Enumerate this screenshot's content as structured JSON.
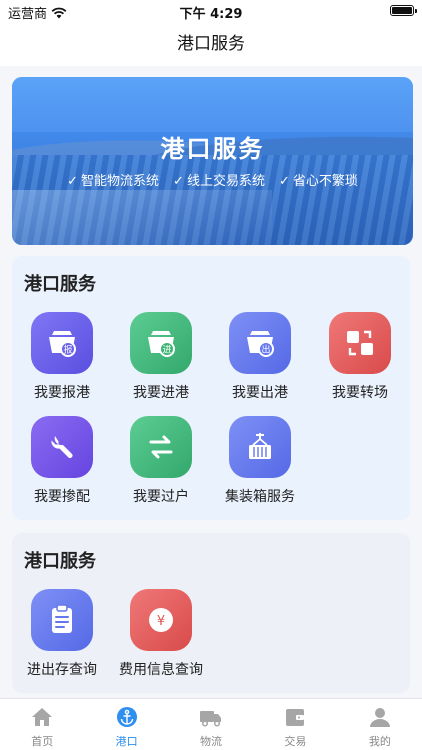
{
  "status_bar": {
    "carrier": "运营商",
    "time": "下午 4:29"
  },
  "nav": {
    "title": "港口服务"
  },
  "banner": {
    "title": "港口服务",
    "features": [
      "智能物流系统",
      "线上交易系统",
      "省心不繁琐"
    ]
  },
  "section1": {
    "title": "港口服务",
    "items": [
      {
        "label": "我要报港",
        "icon": "ship-report-icon",
        "color": "#6c63ee"
      },
      {
        "label": "我要进港",
        "icon": "ship-enter-icon",
        "color": "#3fb57b"
      },
      {
        "label": "我要出港",
        "icon": "ship-exit-icon",
        "color": "#6378ee"
      },
      {
        "label": "我要转场",
        "icon": "transfer-icon",
        "color": "#e55b5b"
      },
      {
        "label": "我要掺配",
        "icon": "wrench-icon",
        "color": "#7b58e8"
      },
      {
        "label": "我要过户",
        "icon": "swap-arrows-icon",
        "color": "#43b47a"
      },
      {
        "label": "集装箱服务",
        "icon": "container-crane-icon",
        "color": "#6278ec"
      }
    ]
  },
  "section2": {
    "title": "港口服务",
    "items": [
      {
        "label": "进出存查询",
        "icon": "clipboard-icon",
        "color": "#6678ee"
      },
      {
        "label": "费用信息查询",
        "icon": "yuan-coin-icon",
        "color": "#e45b5b"
      }
    ]
  },
  "tabs": [
    {
      "label": "首页",
      "icon": "home-icon",
      "active": false
    },
    {
      "label": "港口",
      "icon": "anchor-icon",
      "active": true
    },
    {
      "label": "物流",
      "icon": "truck-icon",
      "active": false
    },
    {
      "label": "交易",
      "icon": "wallet-icon",
      "active": false
    },
    {
      "label": "我的",
      "icon": "user-icon",
      "active": false
    }
  ],
  "colors": {
    "accent": "#2f8ff0",
    "inactive": "#9a9a9a"
  }
}
